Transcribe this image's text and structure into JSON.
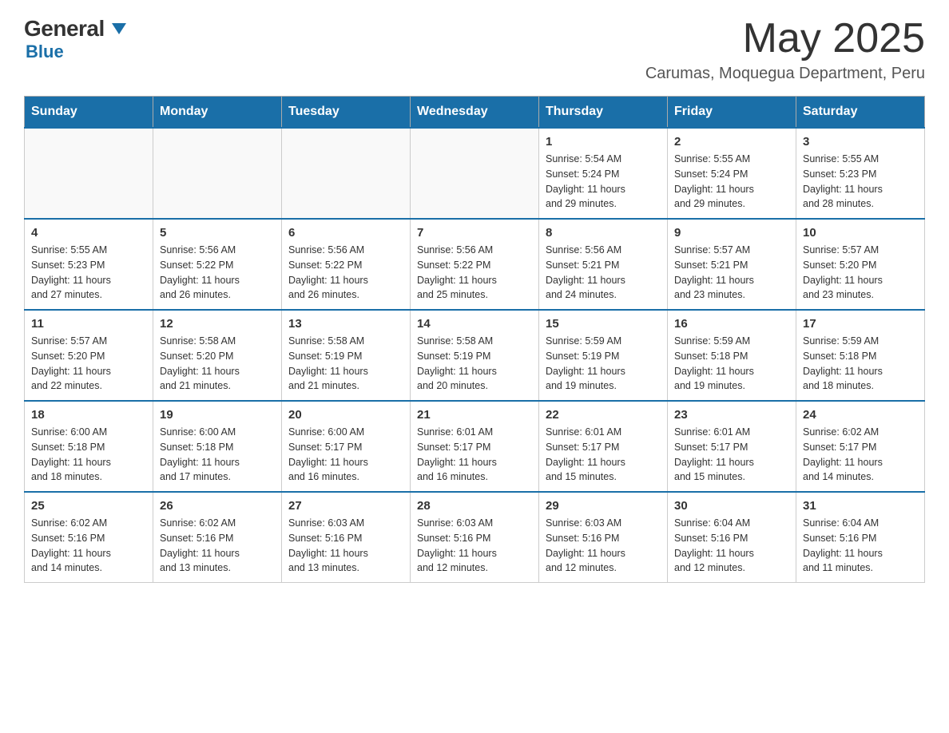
{
  "header": {
    "logo_general": "General",
    "logo_blue": "Blue",
    "month_title": "May 2025",
    "location": "Carumas, Moquegua Department, Peru"
  },
  "days_of_week": [
    "Sunday",
    "Monday",
    "Tuesday",
    "Wednesday",
    "Thursday",
    "Friday",
    "Saturday"
  ],
  "weeks": [
    {
      "days": [
        {
          "number": "",
          "info": ""
        },
        {
          "number": "",
          "info": ""
        },
        {
          "number": "",
          "info": ""
        },
        {
          "number": "",
          "info": ""
        },
        {
          "number": "1",
          "info": "Sunrise: 5:54 AM\nSunset: 5:24 PM\nDaylight: 11 hours\nand 29 minutes."
        },
        {
          "number": "2",
          "info": "Sunrise: 5:55 AM\nSunset: 5:24 PM\nDaylight: 11 hours\nand 29 minutes."
        },
        {
          "number": "3",
          "info": "Sunrise: 5:55 AM\nSunset: 5:23 PM\nDaylight: 11 hours\nand 28 minutes."
        }
      ]
    },
    {
      "days": [
        {
          "number": "4",
          "info": "Sunrise: 5:55 AM\nSunset: 5:23 PM\nDaylight: 11 hours\nand 27 minutes."
        },
        {
          "number": "5",
          "info": "Sunrise: 5:56 AM\nSunset: 5:22 PM\nDaylight: 11 hours\nand 26 minutes."
        },
        {
          "number": "6",
          "info": "Sunrise: 5:56 AM\nSunset: 5:22 PM\nDaylight: 11 hours\nand 26 minutes."
        },
        {
          "number": "7",
          "info": "Sunrise: 5:56 AM\nSunset: 5:22 PM\nDaylight: 11 hours\nand 25 minutes."
        },
        {
          "number": "8",
          "info": "Sunrise: 5:56 AM\nSunset: 5:21 PM\nDaylight: 11 hours\nand 24 minutes."
        },
        {
          "number": "9",
          "info": "Sunrise: 5:57 AM\nSunset: 5:21 PM\nDaylight: 11 hours\nand 23 minutes."
        },
        {
          "number": "10",
          "info": "Sunrise: 5:57 AM\nSunset: 5:20 PM\nDaylight: 11 hours\nand 23 minutes."
        }
      ]
    },
    {
      "days": [
        {
          "number": "11",
          "info": "Sunrise: 5:57 AM\nSunset: 5:20 PM\nDaylight: 11 hours\nand 22 minutes."
        },
        {
          "number": "12",
          "info": "Sunrise: 5:58 AM\nSunset: 5:20 PM\nDaylight: 11 hours\nand 21 minutes."
        },
        {
          "number": "13",
          "info": "Sunrise: 5:58 AM\nSunset: 5:19 PM\nDaylight: 11 hours\nand 21 minutes."
        },
        {
          "number": "14",
          "info": "Sunrise: 5:58 AM\nSunset: 5:19 PM\nDaylight: 11 hours\nand 20 minutes."
        },
        {
          "number": "15",
          "info": "Sunrise: 5:59 AM\nSunset: 5:19 PM\nDaylight: 11 hours\nand 19 minutes."
        },
        {
          "number": "16",
          "info": "Sunrise: 5:59 AM\nSunset: 5:18 PM\nDaylight: 11 hours\nand 19 minutes."
        },
        {
          "number": "17",
          "info": "Sunrise: 5:59 AM\nSunset: 5:18 PM\nDaylight: 11 hours\nand 18 minutes."
        }
      ]
    },
    {
      "days": [
        {
          "number": "18",
          "info": "Sunrise: 6:00 AM\nSunset: 5:18 PM\nDaylight: 11 hours\nand 18 minutes."
        },
        {
          "number": "19",
          "info": "Sunrise: 6:00 AM\nSunset: 5:18 PM\nDaylight: 11 hours\nand 17 minutes."
        },
        {
          "number": "20",
          "info": "Sunrise: 6:00 AM\nSunset: 5:17 PM\nDaylight: 11 hours\nand 16 minutes."
        },
        {
          "number": "21",
          "info": "Sunrise: 6:01 AM\nSunset: 5:17 PM\nDaylight: 11 hours\nand 16 minutes."
        },
        {
          "number": "22",
          "info": "Sunrise: 6:01 AM\nSunset: 5:17 PM\nDaylight: 11 hours\nand 15 minutes."
        },
        {
          "number": "23",
          "info": "Sunrise: 6:01 AM\nSunset: 5:17 PM\nDaylight: 11 hours\nand 15 minutes."
        },
        {
          "number": "24",
          "info": "Sunrise: 6:02 AM\nSunset: 5:17 PM\nDaylight: 11 hours\nand 14 minutes."
        }
      ]
    },
    {
      "days": [
        {
          "number": "25",
          "info": "Sunrise: 6:02 AM\nSunset: 5:16 PM\nDaylight: 11 hours\nand 14 minutes."
        },
        {
          "number": "26",
          "info": "Sunrise: 6:02 AM\nSunset: 5:16 PM\nDaylight: 11 hours\nand 13 minutes."
        },
        {
          "number": "27",
          "info": "Sunrise: 6:03 AM\nSunset: 5:16 PM\nDaylight: 11 hours\nand 13 minutes."
        },
        {
          "number": "28",
          "info": "Sunrise: 6:03 AM\nSunset: 5:16 PM\nDaylight: 11 hours\nand 12 minutes."
        },
        {
          "number": "29",
          "info": "Sunrise: 6:03 AM\nSunset: 5:16 PM\nDaylight: 11 hours\nand 12 minutes."
        },
        {
          "number": "30",
          "info": "Sunrise: 6:04 AM\nSunset: 5:16 PM\nDaylight: 11 hours\nand 12 minutes."
        },
        {
          "number": "31",
          "info": "Sunrise: 6:04 AM\nSunset: 5:16 PM\nDaylight: 11 hours\nand 11 minutes."
        }
      ]
    }
  ]
}
